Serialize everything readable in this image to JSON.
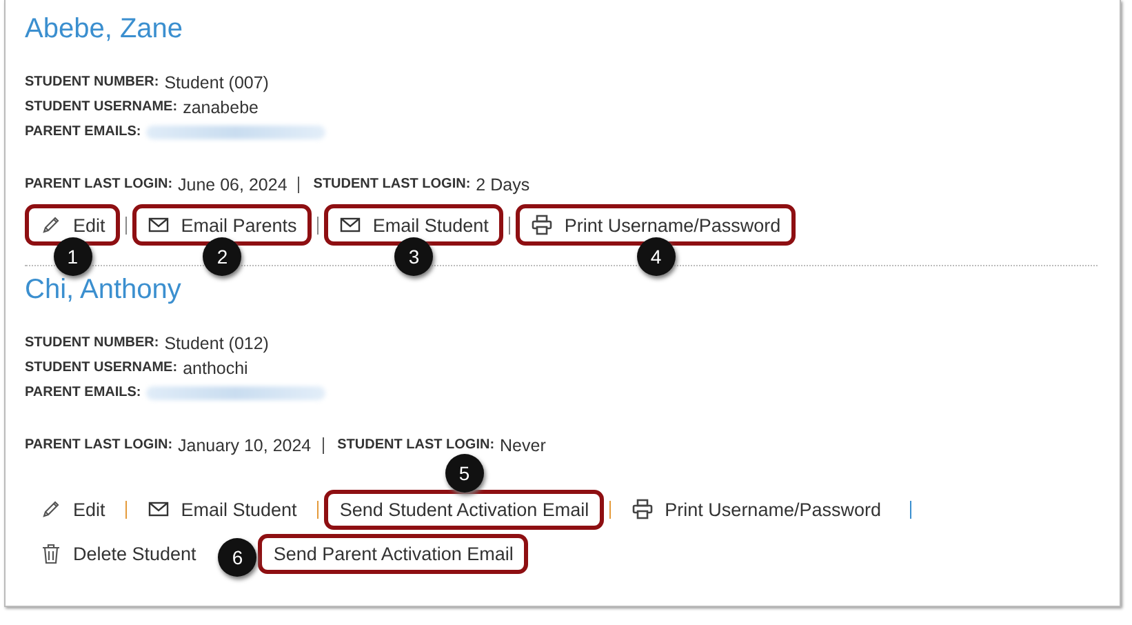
{
  "students": [
    {
      "name": "Abebe, Zane",
      "fields": [
        {
          "kind": "text",
          "label": "STUDENT NUMBER:",
          "value": "Student (007)"
        },
        {
          "kind": "text",
          "label": "STUDENT USERNAME:",
          "value": "zanabebe"
        },
        {
          "kind": "blurred",
          "label": "PARENT EMAILS:"
        }
      ],
      "logins": [
        {
          "label": "PARENT LAST LOGIN:",
          "value": "June 06, 2024"
        },
        {
          "label": "STUDENT LAST LOGIN:",
          "value": "2 Days"
        }
      ],
      "action_rows": [
        [
          {
            "kind": "edit",
            "label": "Edit",
            "highlighted": true,
            "callout": "1",
            "separator_after": true
          },
          {
            "kind": "email",
            "label": "Email Parents",
            "highlighted": true,
            "callout": "2",
            "separator_after": true
          },
          {
            "kind": "email",
            "label": "Email Student",
            "highlighted": true,
            "callout": "3",
            "separator_after": true
          },
          {
            "kind": "print",
            "label": "Print Username/Password",
            "highlighted": true,
            "callout": "4",
            "separator_after": false
          }
        ]
      ]
    },
    {
      "name": "Chi, Anthony",
      "fields": [
        {
          "kind": "text",
          "label": "STUDENT NUMBER:",
          "value": "Student (012)"
        },
        {
          "kind": "text",
          "label": "STUDENT USERNAME:",
          "value": "anthochi"
        },
        {
          "kind": "blurred",
          "label": "PARENT EMAILS:"
        }
      ],
      "logins": [
        {
          "label": "PARENT LAST LOGIN:",
          "value": "January 10, 2024"
        },
        {
          "label": "STUDENT LAST LOGIN:",
          "value": "Never"
        }
      ],
      "action_rows": [
        [
          {
            "kind": "edit",
            "label": "Edit",
            "highlighted": false,
            "separator_after": true
          },
          {
            "kind": "email",
            "label": "Email Student",
            "highlighted": false,
            "separator_after": true
          },
          {
            "kind": "plain",
            "label": "Send Student Activation Email",
            "highlighted": true,
            "callout": "5",
            "separator_after": true
          },
          {
            "kind": "print",
            "label": "Print Username/Password",
            "highlighted": false,
            "separator_after": true
          }
        ],
        [
          {
            "kind": "delete",
            "label": "Delete Student",
            "highlighted": false,
            "separator_after": false
          },
          {
            "kind": "plain",
            "label": "Send Parent Activation Email",
            "highlighted": true,
            "callout": "6",
            "separator_after": false
          }
        ]
      ]
    }
  ]
}
